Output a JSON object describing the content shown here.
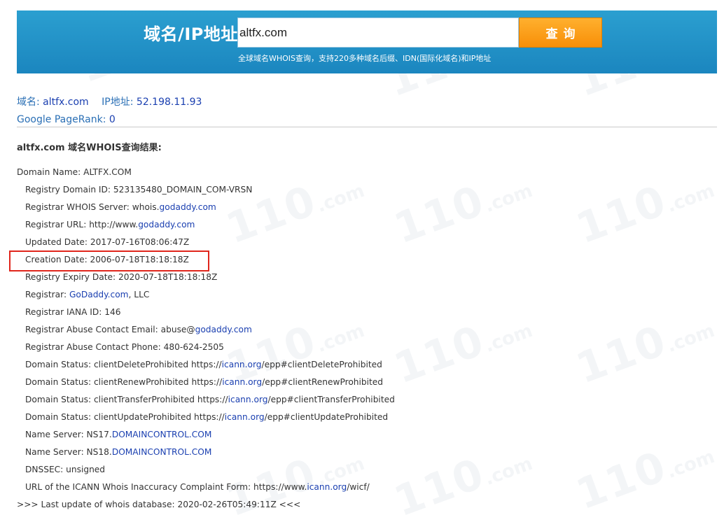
{
  "banner": {
    "label": "域名/IP地址:",
    "search_value": "altfx.com",
    "query_button": "查询",
    "subtitle": "全球域名WHOIS查询，支持220多种域名后缀、IDN(国际化域名)和IP地址"
  },
  "info": {
    "domain_label": "域名:",
    "domain_value": "altfx.com",
    "ip_label": "IP地址:",
    "ip_value": "52.198.11.93",
    "pagerank_label": "Google PageRank:",
    "pagerank_value": "0"
  },
  "result_title": "altfx.com 域名WHOIS查询结果:",
  "watermark": {
    "big": "110",
    "small": ".com"
  },
  "whois": {
    "domain_name": "Domain Name: ALTFX.COM",
    "registry_domain_id": "Registry Domain ID: 523135480_DOMAIN_COM-VRSN",
    "whois_server": {
      "pre": "Registrar WHOIS Server: whois.",
      "link": "godaddy.com"
    },
    "registrar_url": {
      "pre": "Registrar URL: http://www.",
      "link": "godaddy.com"
    },
    "updated_date": "Updated Date: 2017-07-16T08:06:47Z",
    "creation_date": "Creation Date: 2006-07-18T18:18:18Z",
    "expiry_date": "Registry Expiry Date: 2020-07-18T18:18:18Z",
    "registrar": {
      "pre": "Registrar: ",
      "link": "GoDaddy.com",
      "post": ", LLC"
    },
    "iana_id": "Registrar IANA ID: 146",
    "abuse_email": {
      "pre": "Registrar Abuse Contact Email: abuse@",
      "link": "godaddy.com"
    },
    "abuse_phone": "Registrar Abuse Contact Phone: 480-624-2505",
    "status": [
      {
        "pre": "Domain Status: clientDeleteProhibited https://",
        "link": "icann.org",
        "post": "/epp#clientDeleteProhibited"
      },
      {
        "pre": "Domain Status: clientRenewProhibited https://",
        "link": "icann.org",
        "post": "/epp#clientRenewProhibited"
      },
      {
        "pre": "Domain Status: clientTransferProhibited https://",
        "link": "icann.org",
        "post": "/epp#clientTransferProhibited"
      },
      {
        "pre": "Domain Status: clientUpdateProhibited https://",
        "link": "icann.org",
        "post": "/epp#clientUpdateProhibited"
      }
    ],
    "ns1": {
      "pre": "Name Server: NS17.",
      "link": "DOMAINCONTROL.COM"
    },
    "ns2": {
      "pre": "Name Server: NS18.",
      "link": "DOMAINCONTROL.COM"
    },
    "dnssec": "DNSSEC: unsigned",
    "icann_form": {
      "pre": "URL of the ICANN Whois Inaccuracy Complaint Form: https://www.",
      "link": "icann.org",
      "post": "/wicf/"
    },
    "last_update": ">>> Last update of whois database: 2020-02-26T05:49:11Z <<<"
  }
}
